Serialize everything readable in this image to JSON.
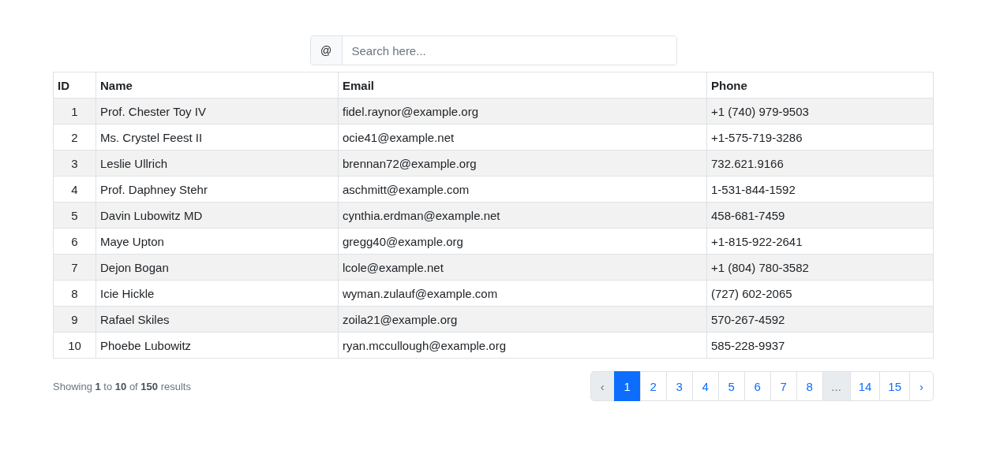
{
  "search": {
    "prefix": "@",
    "placeholder": "Search here..."
  },
  "table": {
    "columns": [
      "ID",
      "Name",
      "Email",
      "Phone"
    ],
    "rows": [
      [
        "1",
        "Prof. Chester Toy IV",
        "fidel.raynor@example.org",
        "+1 (740) 979-9503"
      ],
      [
        "2",
        "Ms. Crystel Feest II",
        "ocie41@example.net",
        "+1-575-719-3286"
      ],
      [
        "3",
        "Leslie Ullrich",
        "brennan72@example.org",
        "732.621.9166"
      ],
      [
        "4",
        "Prof. Daphney Stehr",
        "aschmitt@example.com",
        "1-531-844-1592"
      ],
      [
        "5",
        "Davin Lubowitz MD",
        "cynthia.erdman@example.net",
        "458-681-7459"
      ],
      [
        "6",
        "Maye Upton",
        "gregg40@example.org",
        "+1-815-922-2641"
      ],
      [
        "7",
        "Dejon Bogan",
        "lcole@example.net",
        "+1 (804) 780-3582"
      ],
      [
        "8",
        "Icie Hickle",
        "wyman.zulauf@example.com",
        "(727) 602-2065"
      ],
      [
        "9",
        "Rafael Skiles",
        "zoila21@example.org",
        "570-267-4592"
      ],
      [
        "10",
        "Phoebe Lubowitz",
        "ryan.mccullough@example.org",
        "585-228-9937"
      ]
    ]
  },
  "summary": "Showing **1** to **10** of **150** results",
  "pagination": [
    {
      "kind": "prev",
      "label": "‹",
      "selected": false,
      "disabled": true
    },
    {
      "kind": "page",
      "label": "1",
      "selected": true,
      "disabled": false
    },
    {
      "kind": "page",
      "label": "2",
      "selected": false,
      "disabled": false
    },
    {
      "kind": "page",
      "label": "3",
      "selected": false,
      "disabled": false
    },
    {
      "kind": "page",
      "label": "4",
      "selected": false,
      "disabled": false
    },
    {
      "kind": "page",
      "label": "5",
      "selected": false,
      "disabled": false
    },
    {
      "kind": "page",
      "label": "6",
      "selected": false,
      "disabled": false
    },
    {
      "kind": "page",
      "label": "7",
      "selected": false,
      "disabled": false
    },
    {
      "kind": "page",
      "label": "8",
      "selected": false,
      "disabled": false
    },
    {
      "kind": "ellipsis",
      "label": "...",
      "selected": false,
      "disabled": true
    },
    {
      "kind": "page",
      "label": "14",
      "selected": false,
      "disabled": false
    },
    {
      "kind": "page",
      "label": "15",
      "selected": false,
      "disabled": false
    },
    {
      "kind": "next",
      "label": "›",
      "selected": false,
      "disabled": false
    }
  ]
}
